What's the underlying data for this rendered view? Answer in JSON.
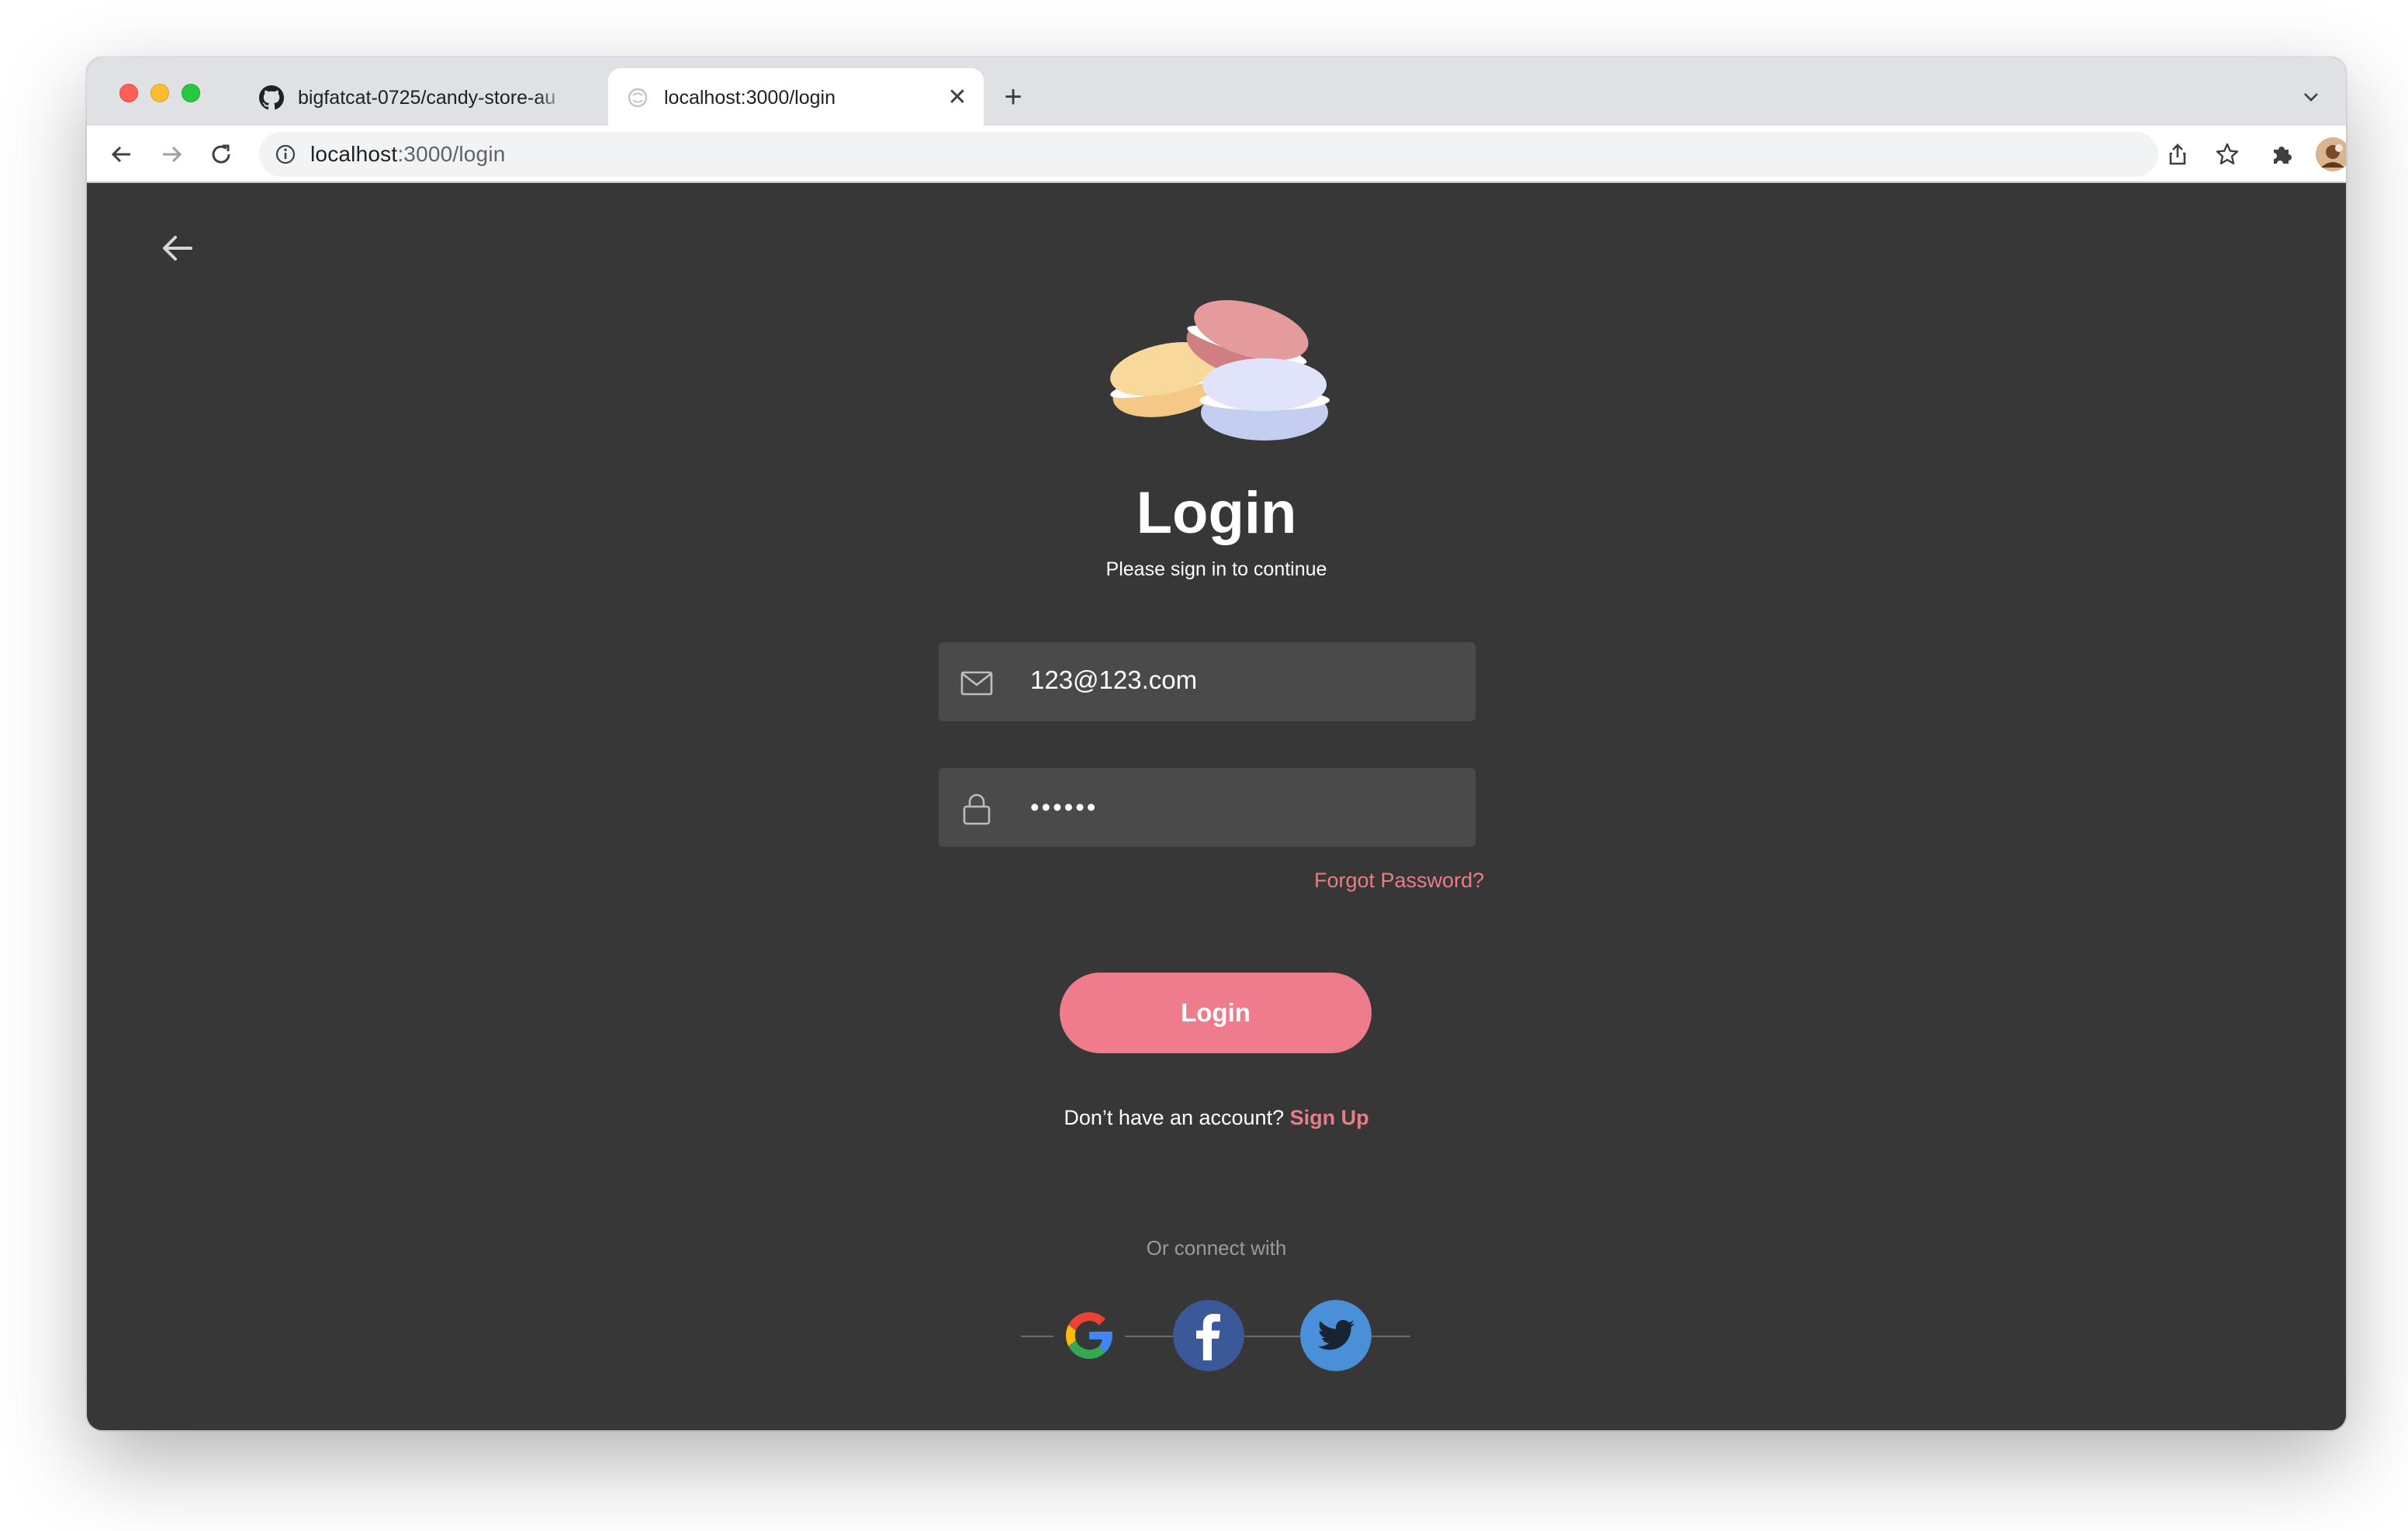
{
  "browser": {
    "tabs": [
      {
        "title": "bigfatcat-0725/candy-store-au",
        "favicon": "github-icon",
        "active": false
      },
      {
        "title": "localhost:3000/login",
        "favicon": "globe-icon",
        "active": true
      }
    ],
    "url_host": "localhost",
    "url_path": ":3000/login"
  },
  "page": {
    "title": "Login",
    "subtitle": "Please sign in to continue",
    "email": {
      "value": "123@123.com",
      "icon": "mail-icon"
    },
    "password": {
      "value": "••••••",
      "icon": "lock-icon"
    },
    "forgot_password": "Forgot Password?",
    "login_button": "Login",
    "no_account_text": "Don’t have an account?",
    "signup_link": "Sign Up",
    "connect_text": "Or connect with",
    "social": [
      "google-icon",
      "facebook-icon",
      "twitter-icon"
    ]
  },
  "colors": {
    "page_background": "#373737",
    "field_background": "#4a4a4a",
    "accent": "#ef7c8c",
    "link": "#e87d86"
  }
}
